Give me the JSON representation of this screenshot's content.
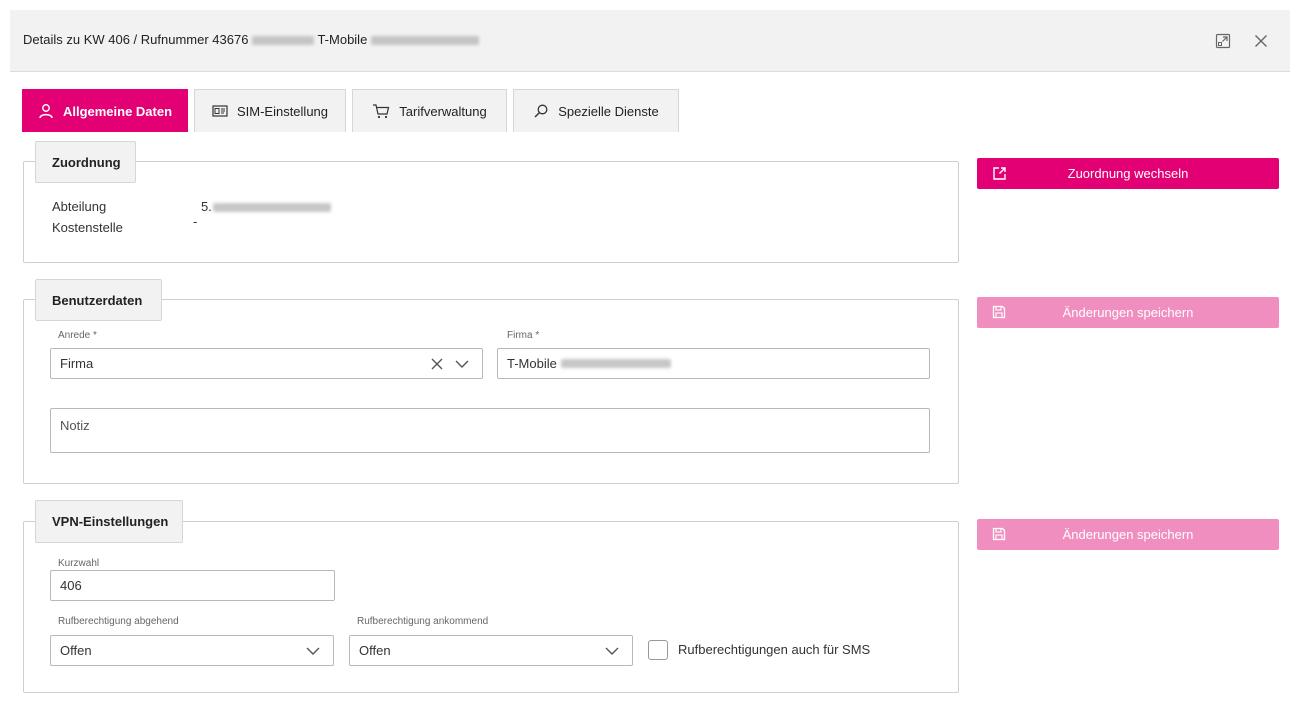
{
  "window": {
    "title_prefix": "Details zu KW 406 / Rufnummer 43676",
    "title_provider": "T-Mobile"
  },
  "tabs": [
    {
      "label": "Allgemeine Daten",
      "icon": "user-icon",
      "active": true
    },
    {
      "label": "SIM-Einstellung",
      "icon": "sim-card-icon",
      "active": false
    },
    {
      "label": "Tarifverwaltung",
      "icon": "cart-icon",
      "active": false
    },
    {
      "label": "Spezielle Dienste",
      "icon": "search-icon",
      "active": false
    }
  ],
  "zuordnung": {
    "legend": "Zuordnung",
    "abteilung_label": "Abteilung",
    "abteilung_value_prefix": "5.",
    "kostenstelle_label": "Kostenstelle",
    "kostenstelle_value": "-",
    "button_label": "Zuordnung wechseln"
  },
  "benutzerdaten": {
    "legend": "Benutzerdaten",
    "anrede_label": "Anrede *",
    "anrede_value": "Firma",
    "firma_label": "Firma *",
    "firma_value_prefix": "T-Mobile",
    "notiz_placeholder": "Notiz",
    "button_label": "Änderungen speichern"
  },
  "vpn": {
    "legend": "VPN-Einstellungen",
    "kurzwahl_label": "Kurzwahl",
    "kurzwahl_value": "406",
    "abgehend_label": "Rufberechtigung abgehend",
    "abgehend_value": "Offen",
    "ankommend_label": "Rufberechtigung ankommend",
    "ankommend_value": "Offen",
    "sms_label": "Rufberechtigungen auch für SMS",
    "button_label": "Änderungen speichern"
  },
  "colors": {
    "brand_magenta": "#e20074",
    "disabled_magenta": "#f08fbf"
  }
}
